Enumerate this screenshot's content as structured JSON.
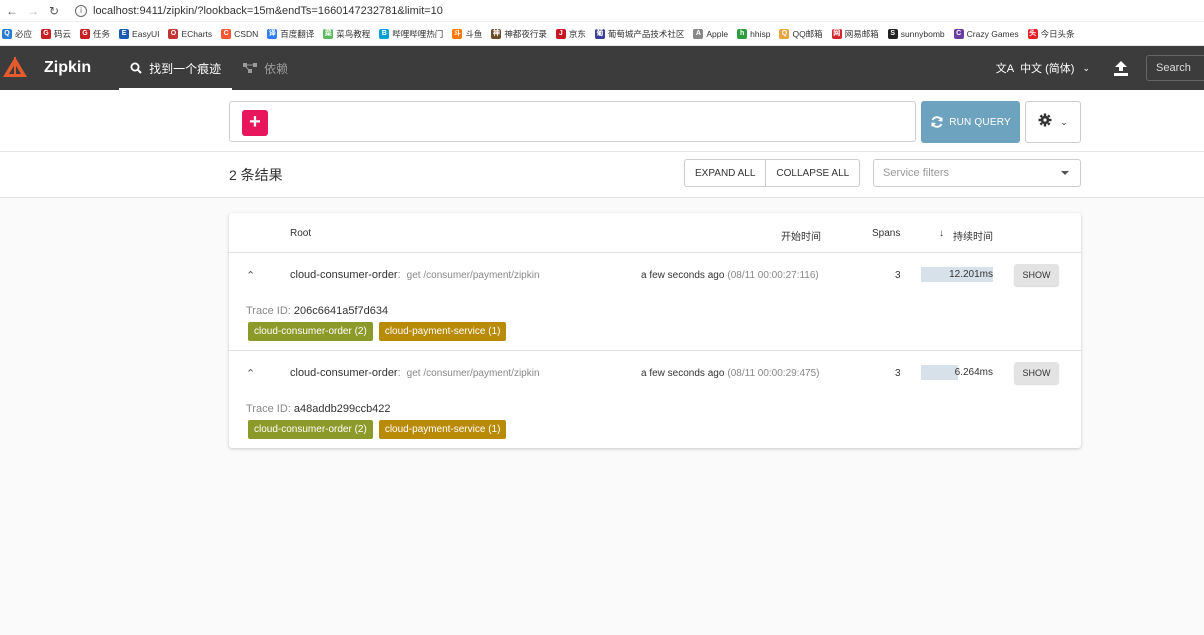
{
  "browser": {
    "url": "localhost:9411/zipkin/?lookback=15m&endTs=1660147232781&limit=10",
    "bookmarks": [
      {
        "label": "必应",
        "color": "#2b7cd3",
        "glyph": "Q"
      },
      {
        "label": "码云",
        "color": "#c71d23",
        "glyph": "G"
      },
      {
        "label": "任务",
        "color": "#c71d23",
        "glyph": "G"
      },
      {
        "label": "EasyUI",
        "color": "#1a5bb5",
        "glyph": "E"
      },
      {
        "label": "ECharts",
        "color": "#c23531",
        "glyph": "O"
      },
      {
        "label": "CSDN",
        "color": "#fc5531",
        "glyph": "C"
      },
      {
        "label": "百度翻译",
        "color": "#2e7cf6",
        "glyph": "译"
      },
      {
        "label": "菜鸟教程",
        "color": "#5cb85c",
        "glyph": "菜"
      },
      {
        "label": "哔哩哔哩热门",
        "color": "#00a1d6",
        "glyph": "B"
      },
      {
        "label": "斗鱼",
        "color": "#ff7700",
        "glyph": "斗"
      },
      {
        "label": "神都夜行录",
        "color": "#6a4c2a",
        "glyph": "神"
      },
      {
        "label": "京东",
        "color": "#c81623",
        "glyph": "JD"
      },
      {
        "label": "葡萄城产品技术社区",
        "color": "#3b3b98",
        "glyph": "葡"
      },
      {
        "label": "Apple",
        "color": "#888888",
        "glyph": "A"
      },
      {
        "label": "hhisp",
        "color": "#2e9d3f",
        "glyph": "h"
      },
      {
        "label": "QQ邮箱",
        "color": "#e7a33e",
        "glyph": "Q"
      },
      {
        "label": "网易邮箱",
        "color": "#d8252b",
        "glyph": "网"
      },
      {
        "label": "sunnybomb",
        "color": "#222222",
        "glyph": "S"
      },
      {
        "label": "Crazy Games",
        "color": "#6b3fa0",
        "glyph": "C"
      },
      {
        "label": "今日头条",
        "color": "#e8202a",
        "glyph": "头"
      }
    ]
  },
  "header": {
    "app_name": "Zipkin",
    "tabs": [
      {
        "label": "找到一个痕迹",
        "active": true
      },
      {
        "label": "依赖",
        "active": false
      }
    ],
    "language": "中文 (简体)",
    "search_placeholder": "Search"
  },
  "query": {
    "add_label": "+",
    "run_label": "RUN QUERY"
  },
  "results": {
    "count_label": "2 条结果",
    "expand_all": "EXPAND ALL",
    "collapse_all": "COLLAPSE ALL",
    "service_filter_placeholder": "Service filters"
  },
  "table": {
    "headers": {
      "root": "Root",
      "start_time": "开始时间",
      "spans": "Spans",
      "duration": "持续时间"
    },
    "rows": [
      {
        "service": "cloud-consumer-order",
        "endpoint": "get /consumer/payment/zipkin",
        "relative_time": "a few seconds ago",
        "timestamp": "(08/11 00:00:27:116)",
        "spans": "3",
        "duration": "12.201ms",
        "duration_fraction": 1.0,
        "show_label": "SHOW",
        "trace_id_label": "Trace ID:",
        "trace_id": "206c6641a5f7d634",
        "tags": [
          {
            "label": "cloud-consumer-order (2)",
            "color": "#8b9a28"
          },
          {
            "label": "cloud-payment-service (1)",
            "color": "#b88a06"
          }
        ]
      },
      {
        "service": "cloud-consumer-order",
        "endpoint": "get /consumer/payment/zipkin",
        "relative_time": "a few seconds ago",
        "timestamp": "(08/11 00:00:29:475)",
        "spans": "3",
        "duration": "6.264ms",
        "duration_fraction": 0.51,
        "show_label": "SHOW",
        "trace_id_label": "Trace ID:",
        "trace_id": "a48addb299ccb422",
        "tags": [
          {
            "label": "cloud-consumer-order (2)",
            "color": "#8b9a28"
          },
          {
            "label": "cloud-payment-service (1)",
            "color": "#b88a06"
          }
        ]
      }
    ]
  }
}
